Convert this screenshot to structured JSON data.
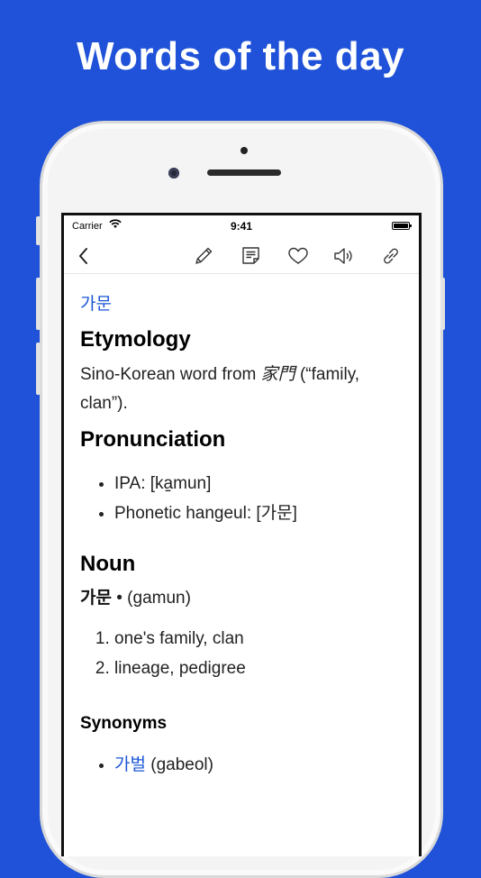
{
  "promo": {
    "title": "Words of the day"
  },
  "status_bar": {
    "carrier": "Carrier",
    "time": "9:41"
  },
  "toolbar": {
    "icons": [
      "back-chevron-icon",
      "pencil-icon",
      "note-icon",
      "heart-icon",
      "speaker-icon",
      "link-icon"
    ]
  },
  "entry": {
    "headword": "가문",
    "etymology": {
      "heading": "Etymology",
      "text_before": "Sino-Korean word from ",
      "hanja": "家門",
      "text_after": " (“family, clan”)."
    },
    "pronunciation": {
      "heading": "Pronunciation",
      "items": [
        "IPA: [ka̠mun]",
        "Phonetic hangeul: [가문]"
      ]
    },
    "noun": {
      "heading": "Noun",
      "word": "가문",
      "romanization": " • (gamun)",
      "senses": [
        "one's family, clan",
        "lineage, pedigree"
      ]
    },
    "synonyms": {
      "heading": "Synonyms",
      "items": [
        {
          "word": "가벌",
          "romanization": " (gabeol)"
        }
      ]
    }
  },
  "colors": {
    "background": "#1f52d8",
    "link": "#1a56d6"
  }
}
